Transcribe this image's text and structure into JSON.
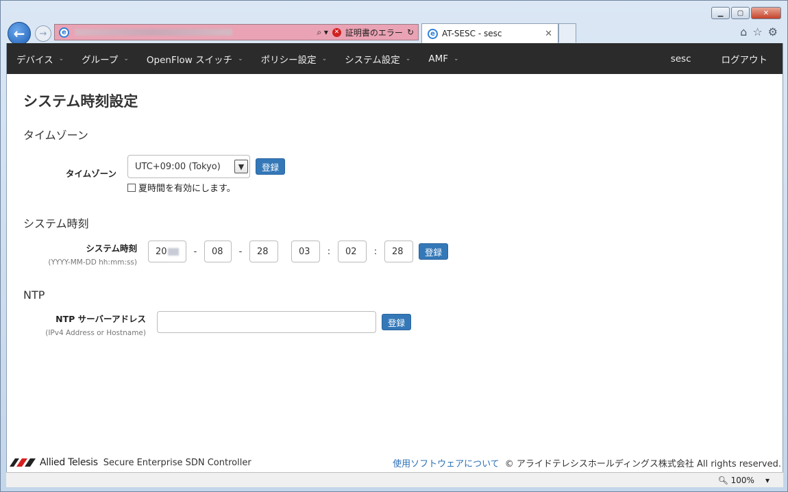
{
  "browser": {
    "address_status": "証明書のエラー",
    "tab_title": "AT-SESC - sesc",
    "zoom": "100%"
  },
  "nav": {
    "items": [
      {
        "label": "デバイス"
      },
      {
        "label": "グループ"
      },
      {
        "label": "OpenFlow スイッチ"
      },
      {
        "label": "ポリシー設定"
      },
      {
        "label": "システム設定"
      },
      {
        "label": "AMF"
      }
    ],
    "user": "sesc",
    "logout": "ログアウト"
  },
  "page": {
    "title": "システム時刻設定",
    "timezone": {
      "section_title": "タイムゾーン",
      "label": "タイムゾーン",
      "selected": "UTC+09:00 (Tokyo)",
      "register": "登録",
      "dst_label": "夏時間を有効にします。"
    },
    "system_time": {
      "section_title": "システム時刻",
      "label": "システム時刻",
      "format_hint": "(YYYY-MM-DD hh:mm:ss)",
      "year": "20",
      "month": "08",
      "day": "28",
      "hour": "03",
      "minute": "02",
      "second": "28",
      "date_sep": "-",
      "time_sep": ":",
      "register": "登録"
    },
    "ntp": {
      "section_title": "NTP",
      "label": "NTP サーバーアドレス",
      "hint": "(IPv4 Address or Hostname)",
      "value": "",
      "register": "登録"
    }
  },
  "footer": {
    "brand": "Allied Telesis",
    "product": "Secure Enterprise SDN Controller",
    "about_link": "使用ソフトウェアについて",
    "copyright": "© アライドテレシスホールディングス株式会社 All rights reserved."
  }
}
